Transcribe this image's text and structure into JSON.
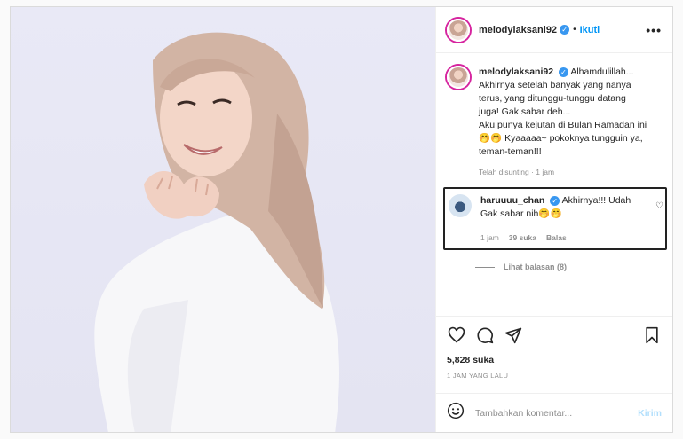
{
  "post": {
    "username": "melodylaksani92",
    "follow_label": "Ikuti",
    "more_label": "•••"
  },
  "caption": {
    "username": "melodylaksani92",
    "text": "Alhamdulillah...\nAkhirnya setelah banyak yang nanya\nterus, yang ditunggu-tunggu datang\njuga! Gak sabar deh...\nAku punya kejutan di Bulan Ramadan ini\n🤭🤭 Kyaaaaa~ pokoknya tungguin ya,\nteman-teman!!!",
    "meta": "Telah disunting · 1 jam"
  },
  "reply": {
    "username": "haruuuu_chan",
    "text": "Akhirnya!!! Udah\nGak sabar nih🤭🤭",
    "time": "1 jam",
    "likes": "39 suka",
    "reply_label": "Balas"
  },
  "view_replies": "Lihat balasan (8)",
  "stats": {
    "likes": "5,828 suka",
    "time": "1 JAM YANG LALU"
  },
  "comment_box": {
    "placeholder": "Tambahkan komentar...",
    "send_label": "Kirim"
  },
  "icons": [
    "heart-icon",
    "comment-icon",
    "share-icon",
    "bookmark-icon",
    "emoji-icon",
    "verified-icon"
  ],
  "colors": {
    "link": "#0095f6",
    "send_disabled": "#b2dffc",
    "verified": "#3897f0",
    "muted": "#8e8e8e"
  }
}
